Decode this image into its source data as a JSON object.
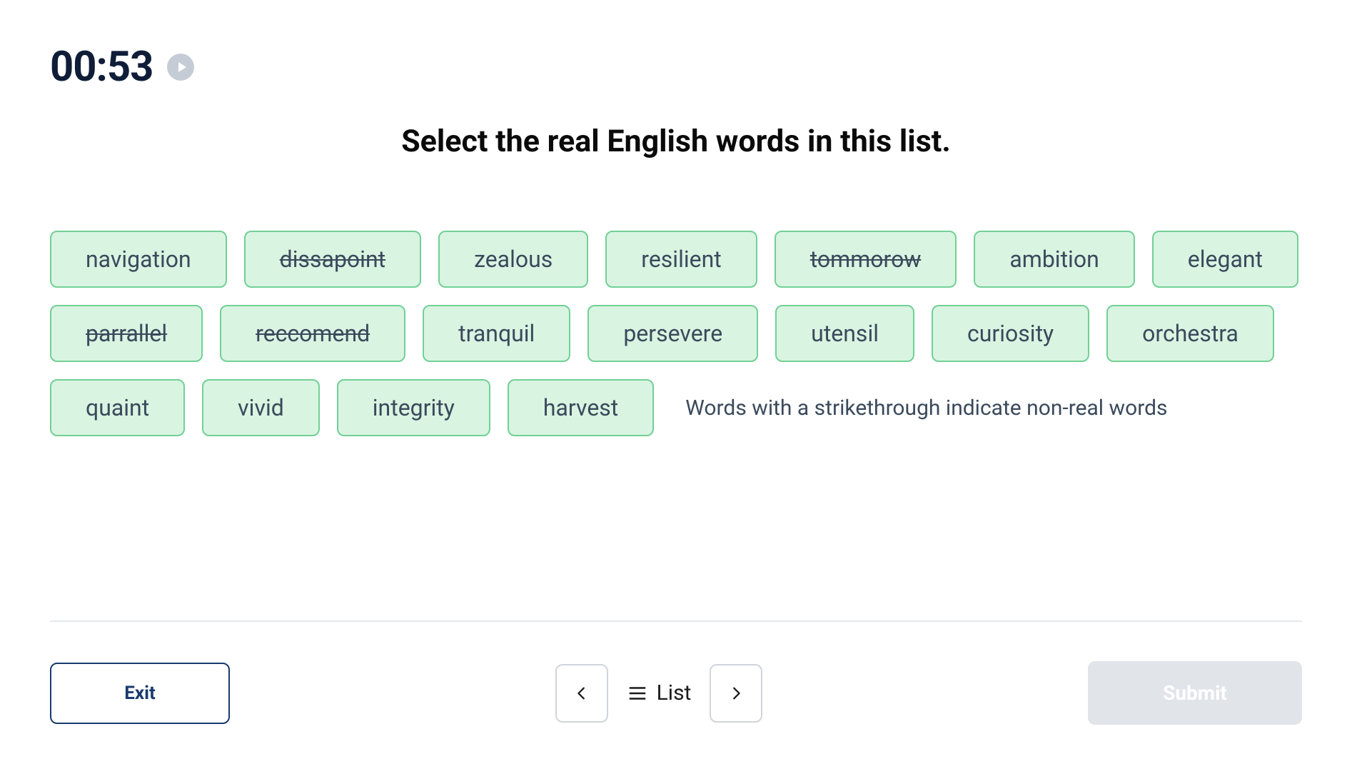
{
  "timer": "00:53",
  "prompt": "Select the real English words in this list.",
  "words": [
    {
      "text": "navigation",
      "strike": false
    },
    {
      "text": "dissapoint",
      "strike": true
    },
    {
      "text": "zealous",
      "strike": false
    },
    {
      "text": "resilient",
      "strike": false
    },
    {
      "text": "tommorow",
      "strike": true
    },
    {
      "text": "ambition",
      "strike": false
    },
    {
      "text": "elegant",
      "strike": false
    },
    {
      "text": "parrallel",
      "strike": true
    },
    {
      "text": "reccomend",
      "strike": true
    },
    {
      "text": "tranquil",
      "strike": false
    },
    {
      "text": "persevere",
      "strike": false
    },
    {
      "text": "utensil",
      "strike": false
    },
    {
      "text": "curiosity",
      "strike": false
    },
    {
      "text": "orchestra",
      "strike": false
    },
    {
      "text": "quaint",
      "strike": false
    },
    {
      "text": "vivid",
      "strike": false
    },
    {
      "text": "integrity",
      "strike": false
    },
    {
      "text": "harvest",
      "strike": false
    }
  ],
  "hint": "Words with a strikethrough indicate non-real words",
  "footer": {
    "exit": "Exit",
    "list": "List",
    "submit": "Submit"
  }
}
